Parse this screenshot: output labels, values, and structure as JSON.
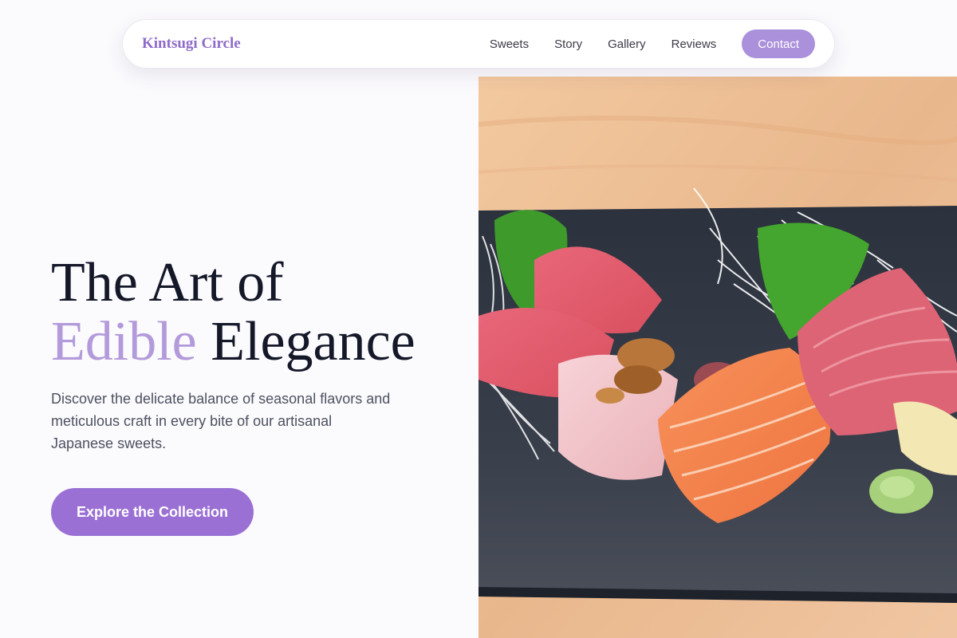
{
  "nav": {
    "brand": "Kintsugi Circle",
    "links": [
      "Sweets",
      "Story",
      "Gallery",
      "Reviews"
    ],
    "contact_label": "Contact"
  },
  "hero": {
    "title_line1": "The Art of",
    "title_accent": "Edible",
    "title_rest": "Elegance",
    "description": "Discover the delicate balance of seasonal flavors and meticulous craft in every bite of our artisanal Japanese sweets.",
    "cta_label": "Explore the Collection"
  },
  "colors": {
    "brand": "#8f6bc9",
    "accent": "#b39ada",
    "cta": "#9a70d4",
    "contact": "#ab90db"
  }
}
